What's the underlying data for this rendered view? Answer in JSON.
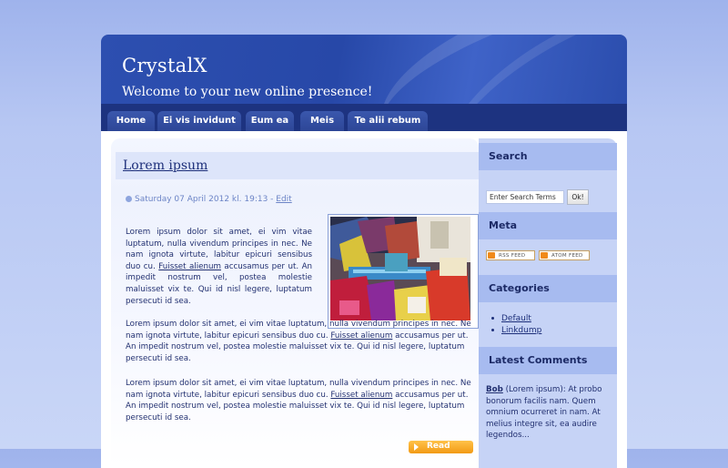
{
  "site": {
    "title": "CrystalX",
    "tagline": "Welcome to your new online presence!"
  },
  "nav": [
    {
      "label": "Home"
    },
    {
      "label": "Ei vis invidunt"
    },
    {
      "label": "Eum ea"
    },
    {
      "label": "Meis"
    },
    {
      "label": "Te alii rebum"
    }
  ],
  "post": {
    "title": "Lorem ipsum",
    "meta": "Saturday 07 April 2012 kl. 19:13 - ",
    "edit_label": "Edit",
    "p1_a": "Lorem ipsum dolor sit amet, ei vim vitae luptatum, nulla vivendum principes in nec. Ne nam ignota virtute, labitur epicuri sensibus duo cu. ",
    "p1_link": "Fuisset alienum",
    "p1_b": " accusamus per ut. An impedit nostrum vel, postea molestie maluisset vix te. Qui id nisl legere, luptatum persecuti id sea.",
    "p2_a": "Lorem ipsum dolor sit amet, ei vim vitae luptatum, nulla vivendum principes in nec. Ne nam ignota virtute, labitur epicuri sensibus duo cu. ",
    "p2_link": "Fuisset alienum",
    "p2_b": " accusamus per ut. An impedit nostrum vel, postea molestie maluisset vix te. Qui id nisl legere, luptatum persecuti id sea.",
    "p3_a": "Lorem ipsum dolor sit amet, ei vim vitae luptatum, nulla vivendum principes in nec. Ne nam ignota virtute, labitur epicuri sensibus duo cu. ",
    "p3_link": "Fuisset alienum",
    "p3_b": " accusamus per ut. An impedit nostrum vel, postea molestie maluisset vix te. Qui id nisl legere, luptatum persecuti id sea.",
    "read_label": "Read"
  },
  "sidebar": {
    "search_heading": "Search",
    "search_value": "Enter Search Terms",
    "search_button": "Ok!",
    "meta_heading": "Meta",
    "rss_label": "RSS FEED",
    "atom_label": "ATOM FEED",
    "categories_heading": "Categories",
    "categories": [
      {
        "label": "Default"
      },
      {
        "label": "Linkdump"
      }
    ],
    "comments_heading": "Latest Comments",
    "comment_author": "Bob",
    "comment_text": " (Lorem ipsum): At probo bonorum facilis nam. Quem omnium ocurreret in nam. At melius integre sit, ea audire legendos..."
  },
  "colors": {
    "header": "#2748a8",
    "nav_bar": "#1d3380",
    "sidebar": "#c6d3f6",
    "sidebar_heading": "#a7bbf0",
    "read_button": "#f29a14"
  }
}
